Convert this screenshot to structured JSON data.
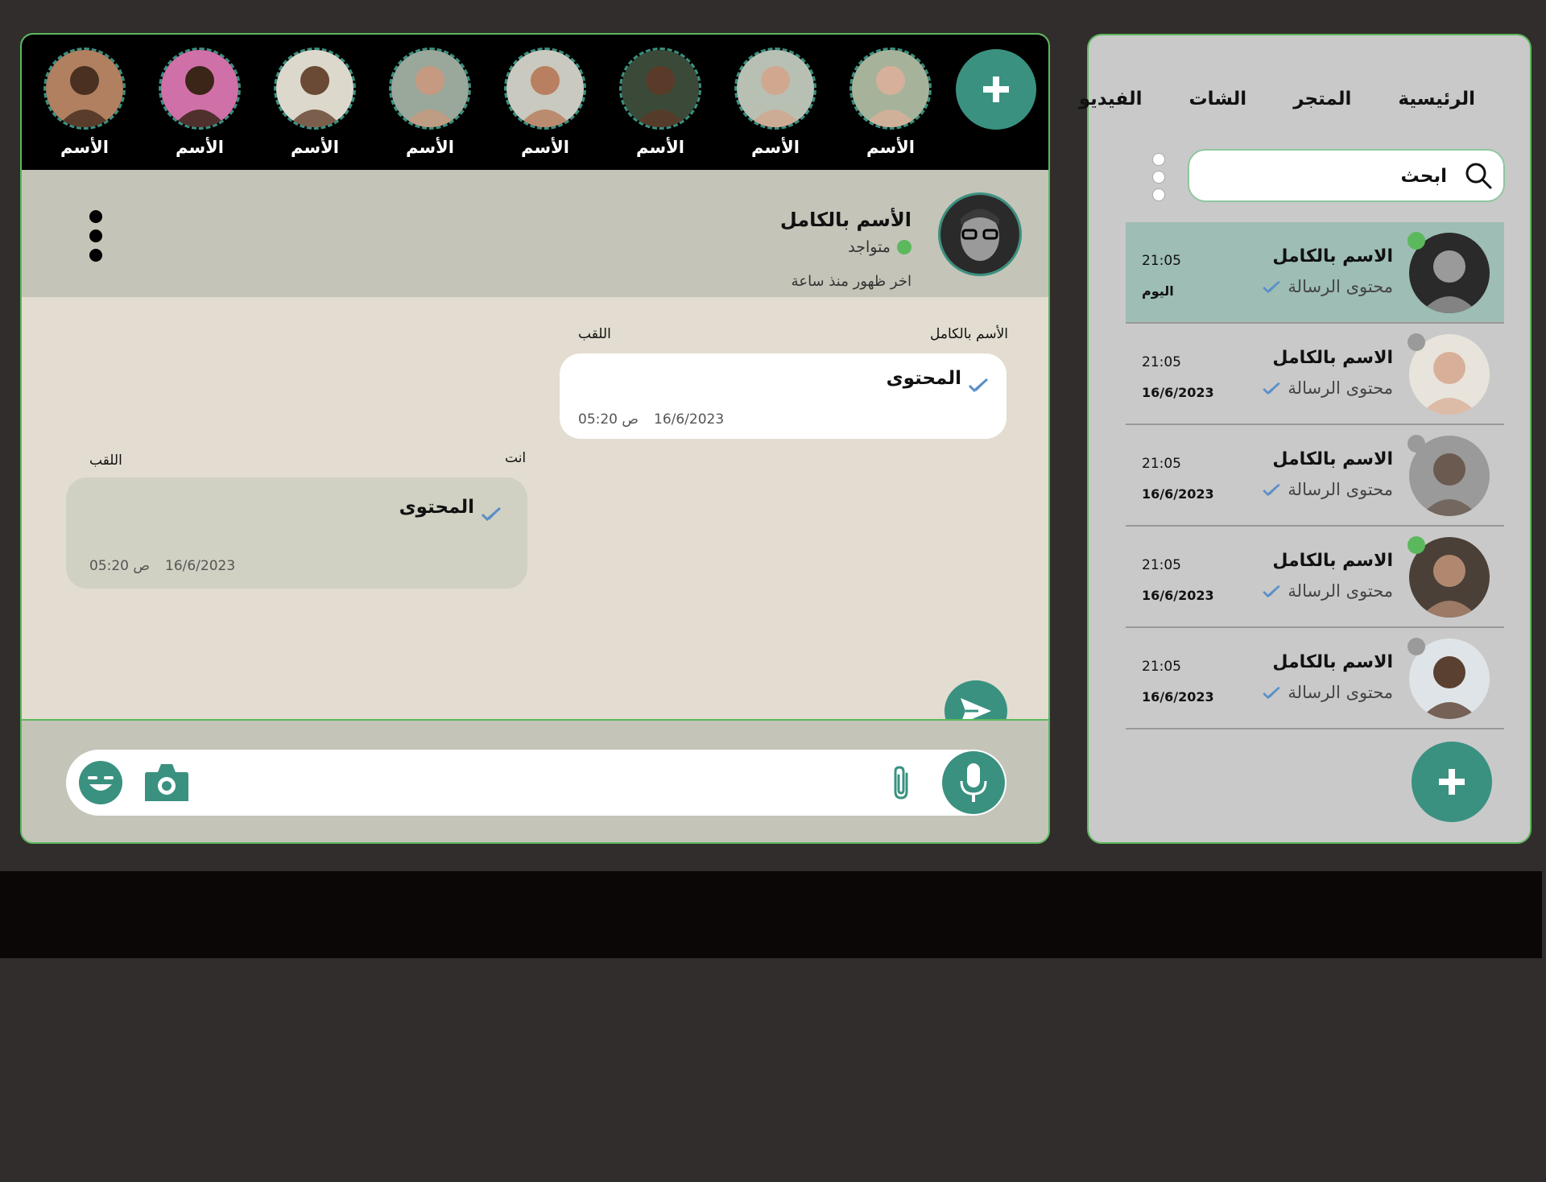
{
  "stories": {
    "items": [
      {
        "label": "الأسم",
        "bg": "#b08060",
        "skin": "#4a3020"
      },
      {
        "label": "الأسم",
        "bg": "#d070a8",
        "skin": "#3a2518"
      },
      {
        "label": "الأسم",
        "bg": "#ddd8cc",
        "skin": "#6a4a35"
      },
      {
        "label": "الأسم",
        "bg": "#9aa79b",
        "skin": "#c59a80"
      },
      {
        "label": "الأسم",
        "bg": "#c9c9c0",
        "skin": "#b88060"
      },
      {
        "label": "الأسم",
        "bg": "#3b4a38",
        "skin": "#5a3a28"
      },
      {
        "label": "الأسم",
        "bg": "#b8c0b4",
        "skin": "#d0a890"
      },
      {
        "label": "الأسم",
        "bg": "#a6b39a",
        "skin": "#d6b09a"
      }
    ],
    "add_icon": "plus-icon"
  },
  "chat_header": {
    "name": "الأسم بالكامل",
    "status": "متواجد",
    "last_seen": "اخر ظهور منذ ساعة",
    "menu_icon": "vertical-dots-icon"
  },
  "messages": [
    {
      "sender": "الأسم بالكامل",
      "nickname": "اللقب",
      "text": "المحتوى",
      "date": "16/6/2023",
      "time": "05:20 ص"
    },
    {
      "sender": "انت",
      "nickname": "اللقب",
      "text": "المحتوى",
      "date": "16/6/2023",
      "time": "05:20 ص"
    }
  ],
  "composer": {
    "placeholder": "",
    "icons": [
      "emoji-icon",
      "camera-icon",
      "paperclip-icon",
      "microphone-icon",
      "send-icon"
    ]
  },
  "sidebar": {
    "nav": [
      "الرئيسية",
      "المتجر",
      "الشات",
      "الفيديو"
    ],
    "search_placeholder": "ابحث",
    "chats": [
      {
        "name": "الاسم بالكامل",
        "preview": "محتوى الرسالة",
        "time": "21:05",
        "date": "اليوم",
        "online": true,
        "active": true
      },
      {
        "name": "الاسم بالكامل",
        "preview": "محتوى الرسالة",
        "time": "21:05",
        "date": "16/6/2023",
        "online": false,
        "active": false
      },
      {
        "name": "الاسم بالكامل",
        "preview": "محتوى الرسالة",
        "time": "21:05",
        "date": "16/6/2023",
        "online": false,
        "active": false
      },
      {
        "name": "الاسم بالكامل",
        "preview": "محتوى الرسالة",
        "time": "21:05",
        "date": "16/6/2023",
        "online": true,
        "active": false
      },
      {
        "name": "الاسم بالكامل",
        "preview": "محتوى الرسالة",
        "time": "21:05",
        "date": "16/6/2023",
        "online": false,
        "active": false
      }
    ]
  },
  "colors": {
    "accent": "#3a9180",
    "online": "#5cb85c",
    "offline": "#9a9a9a",
    "check": "#5b8fc7"
  }
}
